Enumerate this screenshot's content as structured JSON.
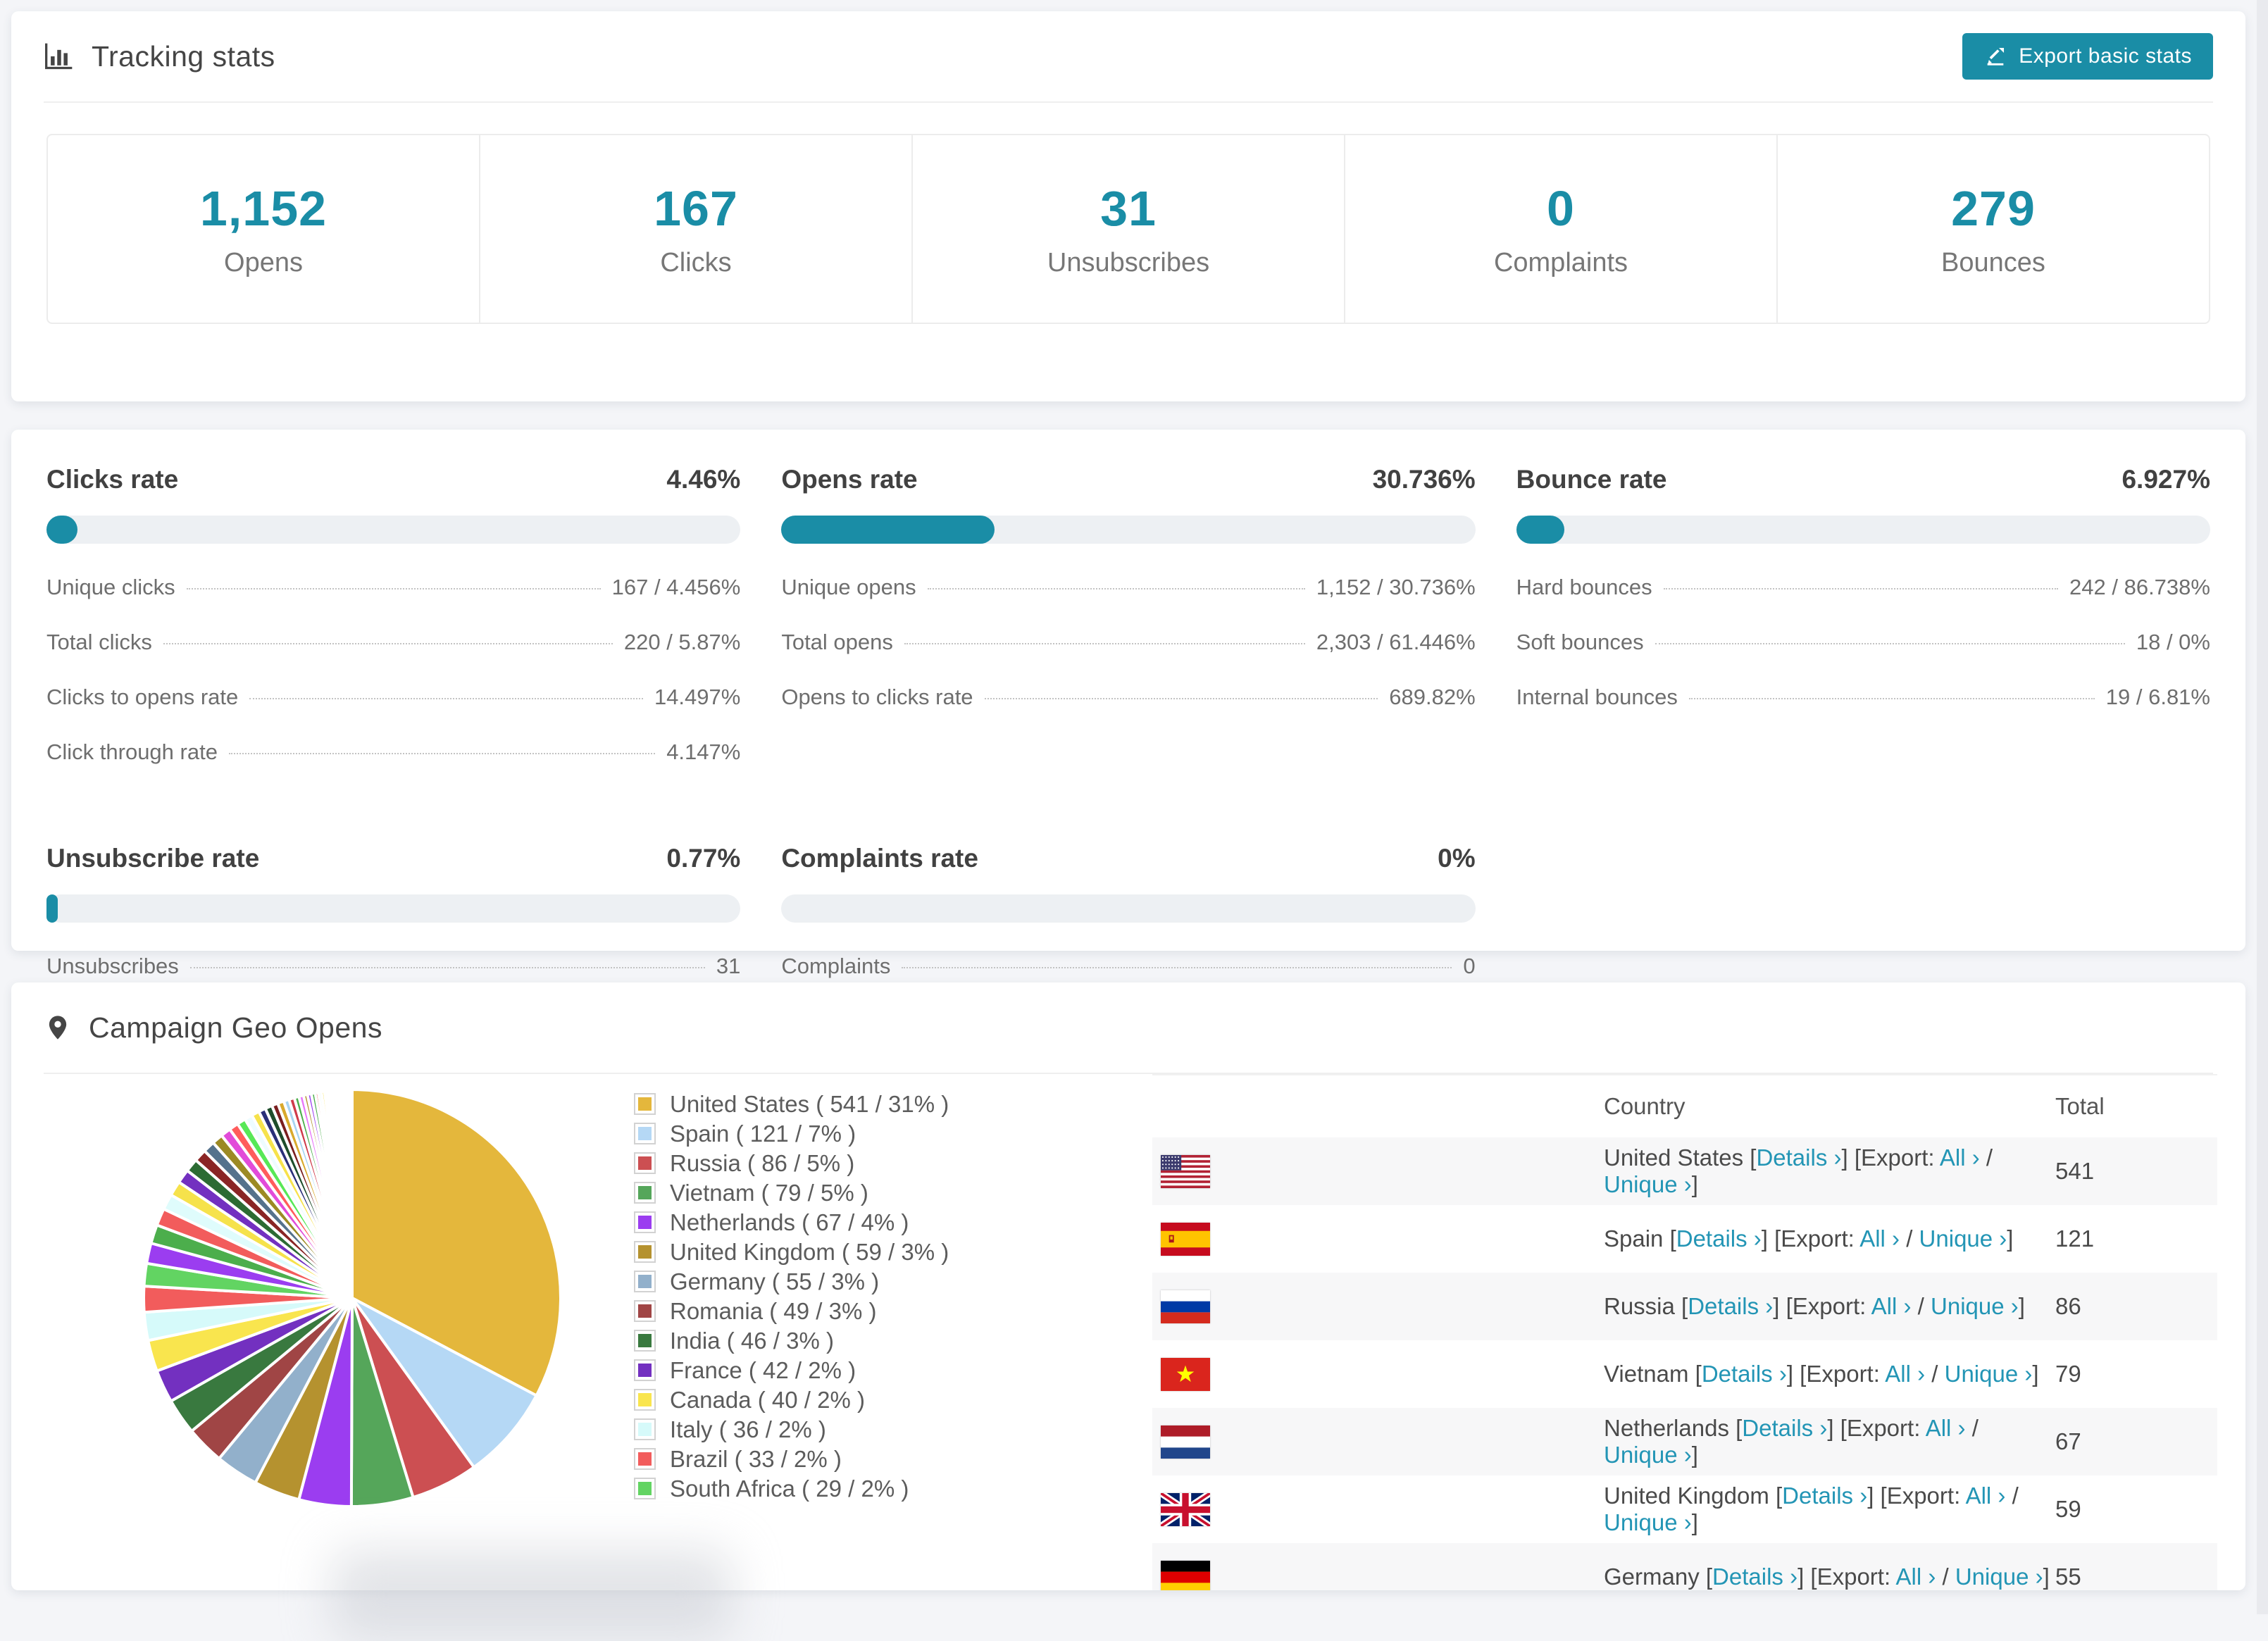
{
  "accent": "#1a8da6",
  "tracking": {
    "title": "Tracking stats",
    "export_label": "Export basic stats"
  },
  "summary": [
    {
      "value": "1,152",
      "label": "Opens"
    },
    {
      "value": "167",
      "label": "Clicks"
    },
    {
      "value": "31",
      "label": "Unsubscribes"
    },
    {
      "value": "0",
      "label": "Complaints"
    },
    {
      "value": "279",
      "label": "Bounces"
    }
  ],
  "rates": [
    {
      "title": "Clicks rate",
      "value": "4.46%",
      "progress": 4.46,
      "rows": [
        {
          "label": "Unique clicks",
          "value": "167 / 4.456%"
        },
        {
          "label": "Total clicks",
          "value": "220 / 5.87%"
        },
        {
          "label": "Clicks to opens rate",
          "value": "14.497%"
        },
        {
          "label": "Click through rate",
          "value": "4.147%"
        }
      ]
    },
    {
      "title": "Opens rate",
      "value": "30.736%",
      "progress": 30.736,
      "rows": [
        {
          "label": "Unique opens",
          "value": "1,152 / 30.736%"
        },
        {
          "label": "Total opens",
          "value": "2,303 / 61.446%"
        },
        {
          "label": "Opens to clicks rate",
          "value": "689.82%"
        }
      ]
    },
    {
      "title": "Bounce rate",
      "value": "6.927%",
      "progress": 6.927,
      "rows": [
        {
          "label": "Hard bounces",
          "value": "242 / 86.738%"
        },
        {
          "label": "Soft bounces",
          "value": "18 / 0%"
        },
        {
          "label": "Internal bounces",
          "value": "19 / 6.81%"
        }
      ]
    },
    {
      "title": "Unsubscribe rate",
      "value": "0.77%",
      "progress": 0.77,
      "rows": [
        {
          "label": "Unsubscribes",
          "value": "31"
        }
      ]
    },
    {
      "title": "Complaints rate",
      "value": "0%",
      "progress": 0,
      "rows": [
        {
          "label": "Complaints",
          "value": "0"
        }
      ]
    }
  ],
  "geo": {
    "title": "Campaign Geo Opens",
    "table": {
      "columns": [
        "Country",
        "Total"
      ],
      "link_labels": {
        "details": "Details",
        "export": "Export:",
        "all": "All",
        "unique": "Unique",
        "arrow": "›"
      },
      "rows": [
        {
          "country": "United States",
          "flag": "us",
          "total": "541"
        },
        {
          "country": "Spain",
          "flag": "es",
          "total": "121"
        },
        {
          "country": "Russia",
          "flag": "ru",
          "total": "86"
        },
        {
          "country": "Vietnam",
          "flag": "vn",
          "total": "79"
        },
        {
          "country": "Netherlands",
          "flag": "nl",
          "total": "67"
        },
        {
          "country": "United Kingdom",
          "flag": "gb",
          "total": "59"
        },
        {
          "country": "Germany",
          "flag": "de",
          "total": "55"
        }
      ]
    }
  },
  "chart_data": {
    "type": "pie",
    "title": "Campaign Geo Opens",
    "start_angle_deg": -90,
    "direction": "clockwise",
    "legend_position": "right",
    "slices": [
      {
        "label": "United States",
        "value": 541,
        "pct": "31%",
        "color": "#e4b73c"
      },
      {
        "label": "Spain",
        "value": 121,
        "pct": "7%",
        "color": "#b5d8f5"
      },
      {
        "label": "Russia",
        "value": 86,
        "pct": "5%",
        "color": "#cc4f52"
      },
      {
        "label": "Vietnam",
        "value": 79,
        "pct": "5%",
        "color": "#55a65a"
      },
      {
        "label": "Netherlands",
        "value": 67,
        "pct": "4%",
        "color": "#9b3df0"
      },
      {
        "label": "United Kingdom",
        "value": 59,
        "pct": "3%",
        "color": "#b5922f"
      },
      {
        "label": "Germany",
        "value": 55,
        "pct": "3%",
        "color": "#92b0cb"
      },
      {
        "label": "Romania",
        "value": 49,
        "pct": "3%",
        "color": "#a04545"
      },
      {
        "label": "India",
        "value": 46,
        "pct": "3%",
        "color": "#39793f"
      },
      {
        "label": "France",
        "value": 42,
        "pct": "2%",
        "color": "#7330c0"
      },
      {
        "label": "Canada",
        "value": 40,
        "pct": "2%",
        "color": "#f9e54e"
      },
      {
        "label": "Italy",
        "value": 36,
        "pct": "2%",
        "color": "#d6fafa"
      },
      {
        "label": "Brazil",
        "value": 33,
        "pct": "2%",
        "color": "#f25c5c"
      },
      {
        "label": "South Africa",
        "value": 29,
        "pct": "2%",
        "color": "#62d462"
      }
    ],
    "others": {
      "note": "many small unlabeled countries rendered as thin slices",
      "values": [
        26,
        24,
        22,
        20,
        19,
        18,
        17,
        16,
        15,
        14,
        13,
        12,
        11,
        10,
        10,
        9,
        9,
        8,
        8,
        7,
        7,
        6,
        6,
        5,
        5,
        5,
        4,
        4,
        4,
        3,
        3,
        3,
        3,
        2,
        2,
        2,
        2,
        2,
        2,
        1,
        1,
        1,
        1,
        1,
        1,
        1,
        1,
        1,
        1,
        1
      ],
      "colors": [
        "#9b3df0",
        "#4cae4c",
        "#f25c5c",
        "#dffcfc",
        "#f6e24b",
        "#7330c0",
        "#2c6b33",
        "#8a2525",
        "#55728c",
        "#9c8a24",
        "#e24bd9",
        "#ff5c5c",
        "#57e857",
        "#eefcff",
        "#f6e24b",
        "#2a2f78",
        "#1e4d2b",
        "#7a1f1f",
        "#d9a92c",
        "#a8d4f2",
        "#cf3a4a",
        "#4cae4c",
        "#e879f9",
        "#b5922f"
      ]
    }
  }
}
